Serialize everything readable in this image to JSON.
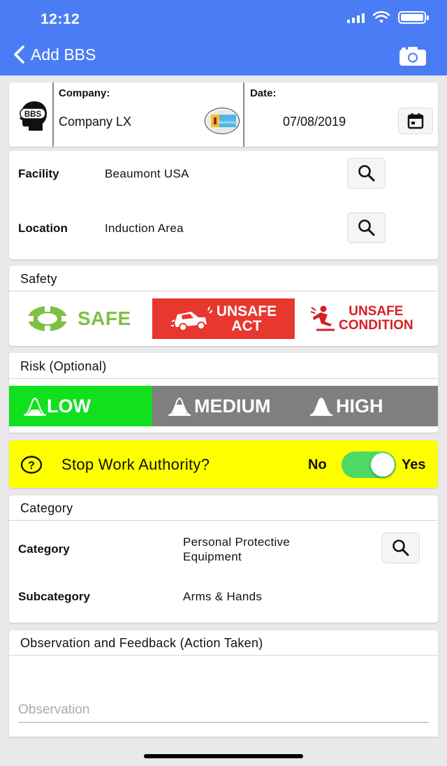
{
  "status_bar": {
    "time": "12:12"
  },
  "nav": {
    "title": "Add BBS",
    "back_icon": "chevron-left-icon",
    "camera_icon": "camera-icon"
  },
  "company_card": {
    "logo_text": "BBS",
    "company_label": "Company:",
    "company_value": "Company LX",
    "company_logo_text": "Services",
    "date_label": "Date:",
    "date_value": "07/08/2019"
  },
  "facility_card": {
    "facility_label": "Facility",
    "facility_value": "Beaumont USA",
    "location_label": "Location",
    "location_value": "Induction Area"
  },
  "safety": {
    "title": "Safety",
    "safe_label": "SAFE",
    "unsafe_act_line1": "UNSAFE",
    "unsafe_act_line2": "ACT",
    "unsafe_condition_line1": "UNSAFE",
    "unsafe_condition_line2": "CONDITION"
  },
  "risk": {
    "title": "Risk (Optional)",
    "low": "LOW",
    "medium": "MEDIUM",
    "high": "HIGH",
    "selected": "LOW"
  },
  "stop_work": {
    "question": "Stop Work Authority?",
    "no_label": "No",
    "yes_label": "Yes",
    "value": "Yes"
  },
  "category_card": {
    "title": "Category",
    "category_label": "Category",
    "category_value": "Personal Protective Equipment",
    "subcategory_label": "Subcategory",
    "subcategory_value": "Arms & Hands"
  },
  "observation": {
    "title": "Observation and Feedback (Action Taken)",
    "placeholder": "Observation"
  },
  "colors": {
    "header": "#4a7cf5",
    "safe_green": "#7dc142",
    "unsafe_red": "#e8372e",
    "risk_low_green": "#12e01f",
    "risk_inactive_gray": "#7f7f7f",
    "stop_work_yellow": "#ffff00",
    "toggle_on": "#4cd964"
  }
}
